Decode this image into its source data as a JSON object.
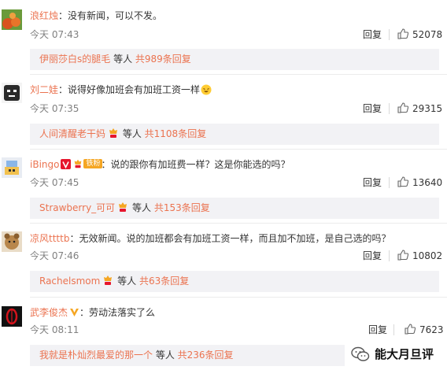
{
  "comments": [
    {
      "username": "浪红烛",
      "colon": "：",
      "text": "没有新闻，可以不发。",
      "time": "今天 07:43",
      "reply_label": "回复",
      "likes": "52078",
      "sub": {
        "name": "伊丽莎白s的腿毛",
        "etc": " 等人 ",
        "count": "共989条回复"
      }
    },
    {
      "username": "刘二娃",
      "colon": "：",
      "text": "说得好像加班会有加班工资一样",
      "time": "今天 07:35",
      "reply_label": "回复",
      "likes": "29315",
      "sub": {
        "name": "人间清醒老干妈",
        "etc": " 等人 ",
        "count": "共1108条回复"
      }
    },
    {
      "username": "iBingo",
      "colon": "：",
      "badge_text": "铁粉",
      "text": "说的跟你有加班费一样？这是你能选的吗？",
      "time": "今天 07:45",
      "reply_label": "回复",
      "likes": "13640",
      "sub": {
        "name": "Strawberry_可可",
        "etc": " 等人 ",
        "count": "共153条回复"
      }
    },
    {
      "username": "凉风ttttb",
      "colon": "：",
      "text": "无效新闻。说的加班都会有加班工资一样，而且加不加班，是自己选的吗？",
      "time": "今天 07:46",
      "reply_label": "回复",
      "likes": "10802",
      "sub": {
        "name": "Rachelsmom",
        "etc": " 等人 ",
        "count": "共63条回复"
      }
    },
    {
      "username": "武李俊杰",
      "colon": "：",
      "text": "劳动法落实了么",
      "time": "今天 08:11",
      "reply_label": "回复",
      "likes": "7623",
      "sub": {
        "name": "我就是朴灿烈最爱的那一个",
        "etc": " 等人 ",
        "count": "共236条回复"
      }
    }
  ],
  "watermark": {
    "text": "能大月旦评"
  },
  "colors": {
    "username": "#eb7350",
    "meta": "#808080",
    "subbox_bg": "#f2f2f5",
    "vip_orange": "#f5a623",
    "v_red": "#e6162d"
  }
}
